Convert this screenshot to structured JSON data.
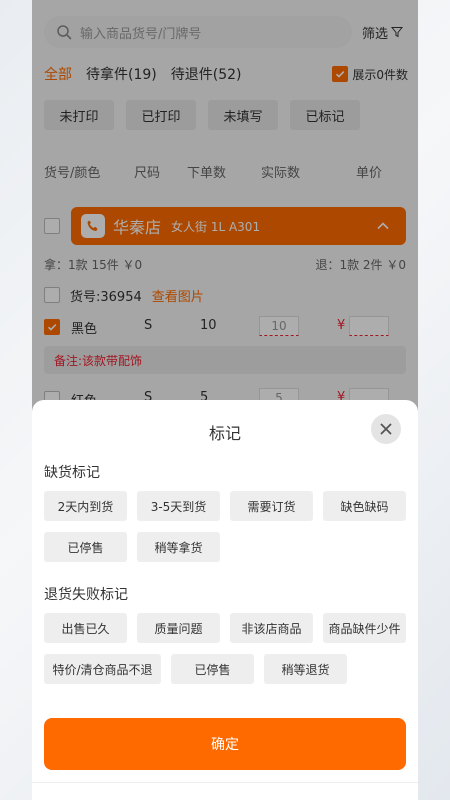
{
  "search": {
    "placeholder": "输入商品货号/门牌号"
  },
  "filter": {
    "label": "筛选"
  },
  "tabs": [
    {
      "label": "全部",
      "active": true
    },
    {
      "label": "待拿件(19)"
    },
    {
      "label": "待退件(52)"
    }
  ],
  "show_zero": {
    "label": "展示0件数",
    "checked": true
  },
  "print_filters": [
    "未打印",
    "已打印",
    "未填写",
    "已标记"
  ],
  "columns": [
    "货号/颜色",
    "尺码",
    "下单数",
    "实际数",
    "单价"
  ],
  "store": {
    "name": "华秦店",
    "address": "女人街 1L A301"
  },
  "summary": {
    "pickup": "拿：1款 15件 ￥0",
    "return": "退：1款 2件 ￥0"
  },
  "sku": {
    "label": "货号:36954",
    "view_image": "查看图片"
  },
  "items": [
    {
      "color": "黑色",
      "size": "S",
      "ordered": "10",
      "actual": "10",
      "currency": "¥"
    },
    {
      "color": "红色",
      "size": "S",
      "ordered": "5",
      "actual": "5",
      "currency": "¥"
    }
  ],
  "note": "备注:该款带配饰",
  "sheet": {
    "title": "标记",
    "shortage_title": "缺货标记",
    "shortage_options": [
      "2天内到货",
      "3-5天到货",
      "需要订货",
      "缺色缺码",
      "已停售",
      "稍等拿货"
    ],
    "return_fail_title": "退货失败标记",
    "return_fail_options": [
      "出售已久",
      "质量问题",
      "非该店商品",
      "商品缺件少件",
      "特价/清仓商品不退",
      "已停售",
      "稍等退货"
    ],
    "confirm_label": "确定"
  },
  "colors": {
    "accent": "#ff6a00",
    "danger": "#e23333"
  }
}
